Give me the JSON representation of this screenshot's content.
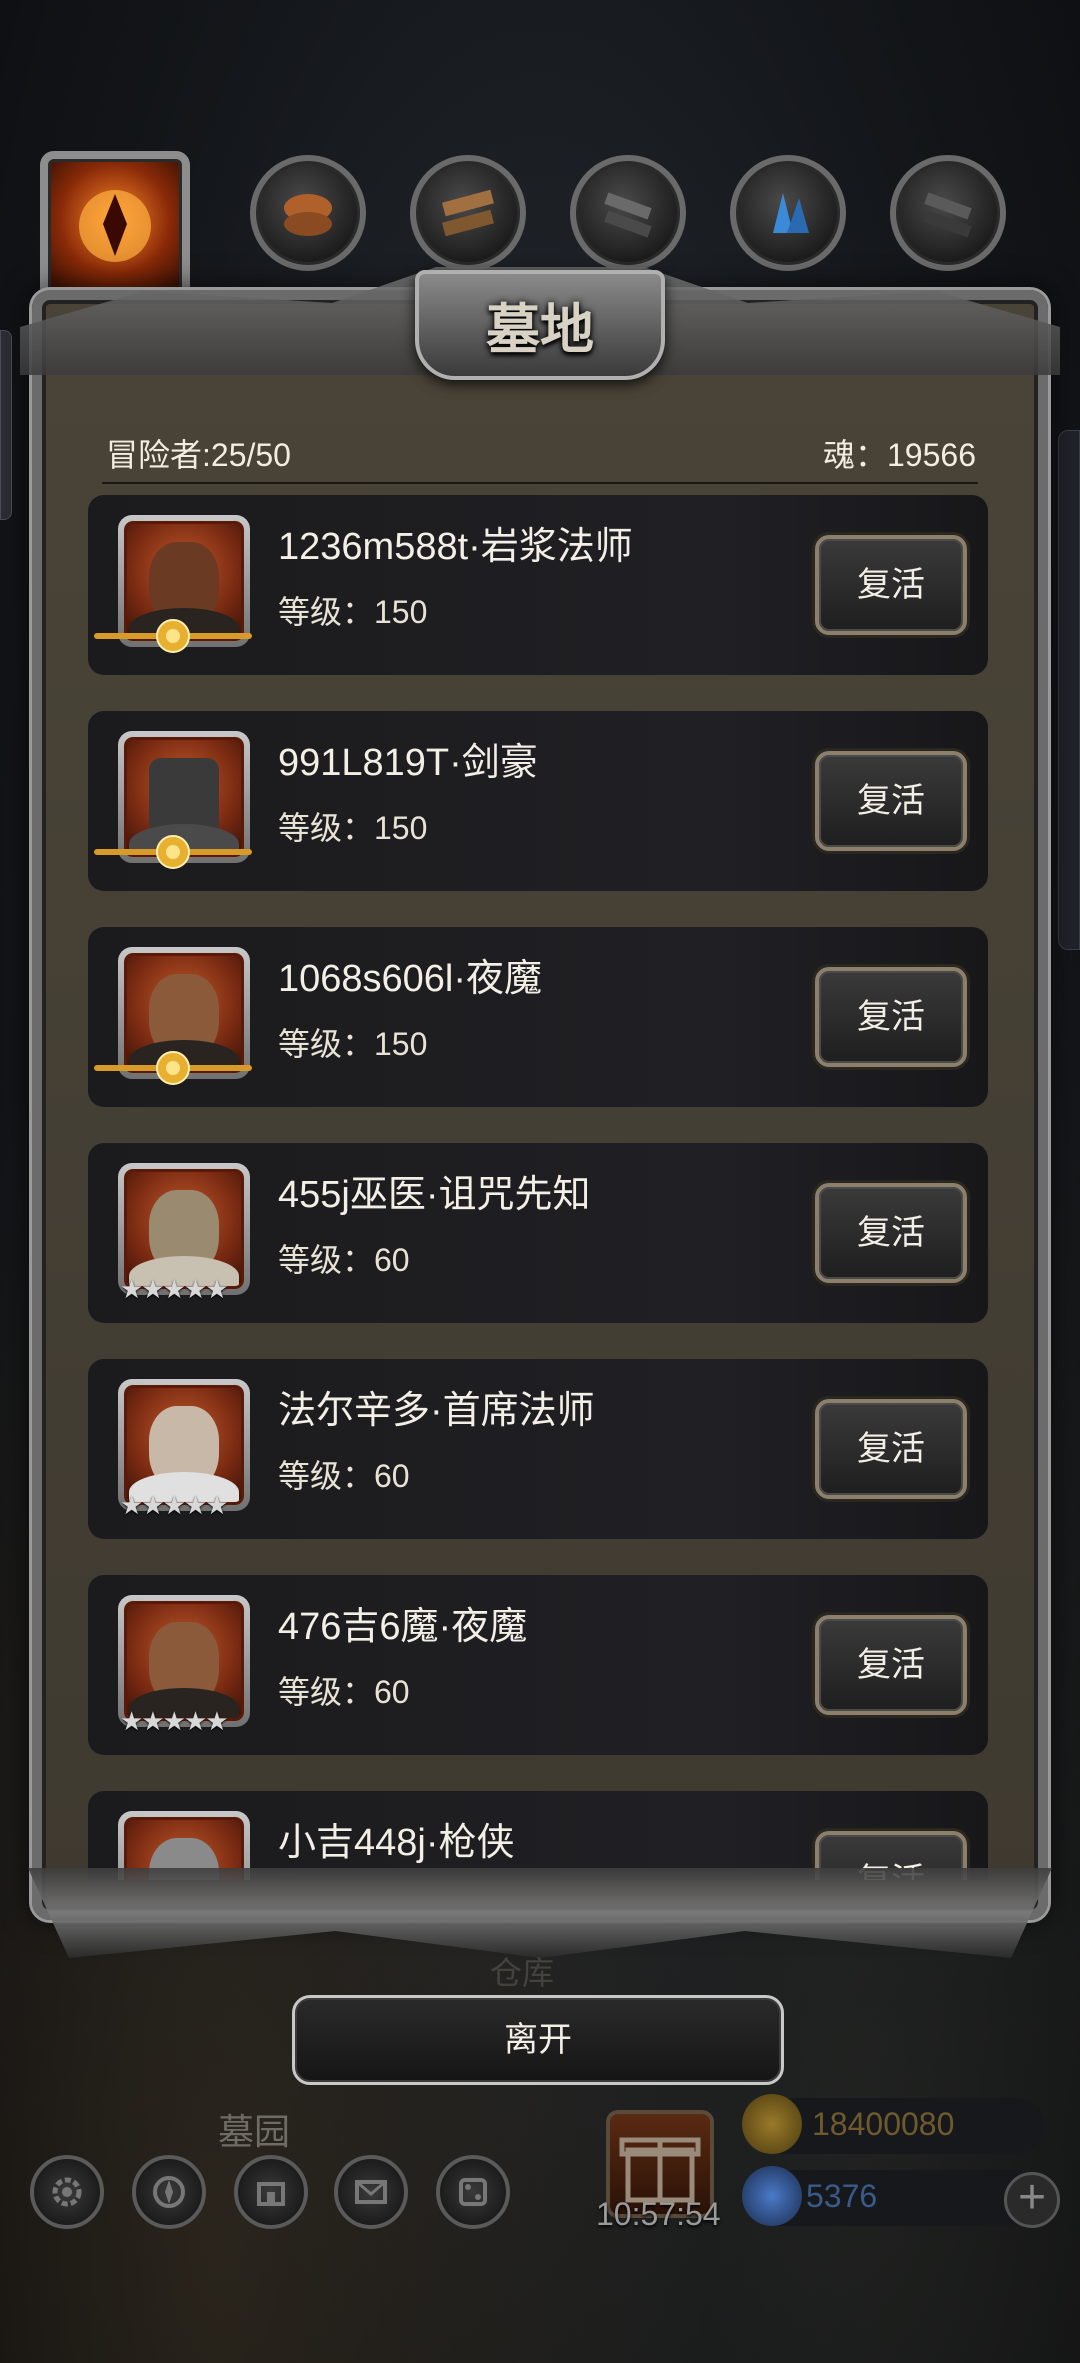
{
  "panel": {
    "title": "墓地",
    "adventurers_label": "冒险者:25/50",
    "soul_label": "魂：19566"
  },
  "heroes": [
    {
      "name": "1236m588t·岩浆法师",
      "level": "等级：150",
      "rank": "gold-badge",
      "skin": "#6a3a22",
      "revive": "复活"
    },
    {
      "name": "991L819T·剑豪",
      "level": "等级：150",
      "rank": "gold-badge",
      "skin": "#3a3a3a",
      "revive": "复活"
    },
    {
      "name": "1068s606l·夜魔",
      "level": "等级：150",
      "rank": "gold-badge",
      "skin": "#8a5a3a",
      "revive": "复活"
    },
    {
      "name": "455j巫医·诅咒先知",
      "level": "等级：60",
      "rank": "★★★★★",
      "skin": "#9a8a70",
      "revive": "复活"
    },
    {
      "name": "法尔辛多·首席法师",
      "level": "等级：60",
      "rank": "★★★★★",
      "skin": "#c8b8a8",
      "revive": "复活"
    },
    {
      "name": "476吉6魔·夜魔",
      "level": "等级：60",
      "rank": "★★★★★",
      "skin": "#8a5a3a",
      "revive": "复活"
    },
    {
      "name": "小吉448j·枪侠",
      "level": "",
      "rank": "",
      "skin": "#8a8a8a",
      "revive": "复活"
    }
  ],
  "leave_label": "离开",
  "ghost_label": "仓库",
  "bottom": {
    "graveyard_label": "墓园",
    "timer": "10:57:54",
    "gold": "18400080",
    "gems": "5376",
    "plus": "+"
  },
  "colors": {
    "gold": "#6f5a2e",
    "gem": "#3a5a8a",
    "panel_bg": "#4a4438"
  }
}
